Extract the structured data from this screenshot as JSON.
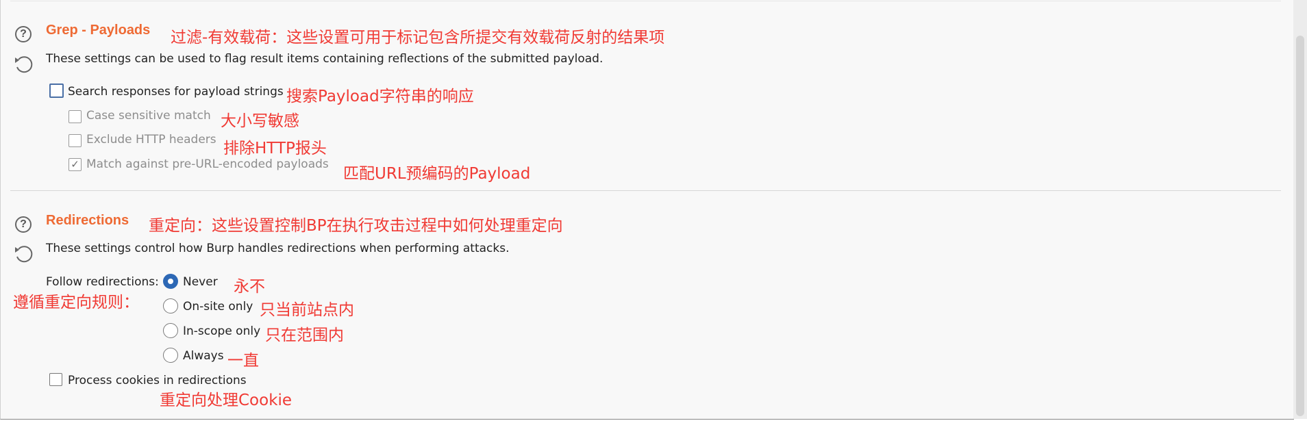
{
  "grep": {
    "title": "Grep - Payloads",
    "annotation": "过滤-有效载荷：这些设置可用于标记包含所提交有效载荷反射的结果项",
    "description": "These settings can be used to flag result items containing reflections of the submitted payload.",
    "help_icon": "help-circle-icon",
    "reset_icon": "reset-icon",
    "options": [
      {
        "label": "Search responses for payload strings",
        "checked": false,
        "enabled": true,
        "annotation": "搜索Payload字符串的响应"
      },
      {
        "label": "Case sensitive match",
        "checked": false,
        "enabled": false,
        "annotation": "大小写敏感"
      },
      {
        "label": "Exclude HTTP headers",
        "checked": false,
        "enabled": false,
        "annotation": "排除HTTP报头"
      },
      {
        "label": "Match against pre-URL-encoded payloads",
        "checked": true,
        "enabled": false,
        "annotation": "匹配URL预编码的Payload"
      }
    ]
  },
  "redirections": {
    "title": "Redirections",
    "annotation": "重定向：这些设置控制BP在执行攻击过程中如何处理重定向",
    "description": "These settings control how Burp handles redirections when performing attacks.",
    "help_icon": "help-circle-icon",
    "reset_icon": "reset-icon",
    "follow_label": "Follow redirections:",
    "follow_annotation": "遵循重定向规则：",
    "radio_options": [
      {
        "label": "Never",
        "selected": true,
        "annotation": "永不"
      },
      {
        "label": "On-site only",
        "selected": false,
        "annotation": "只当前站点内"
      },
      {
        "label": "In-scope only",
        "selected": false,
        "annotation": "只在范围内"
      },
      {
        "label": "Always",
        "selected": false,
        "annotation": "一直"
      }
    ],
    "process_cookies": {
      "label": "Process cookies in redirections",
      "checked": false,
      "annotation": "重定向处理Cookie"
    }
  },
  "colors": {
    "section_title": "#ee6a34",
    "annotation": "#f03a34",
    "radio_selected": "#2d68b5",
    "panel_background": "#f8f8f8"
  }
}
